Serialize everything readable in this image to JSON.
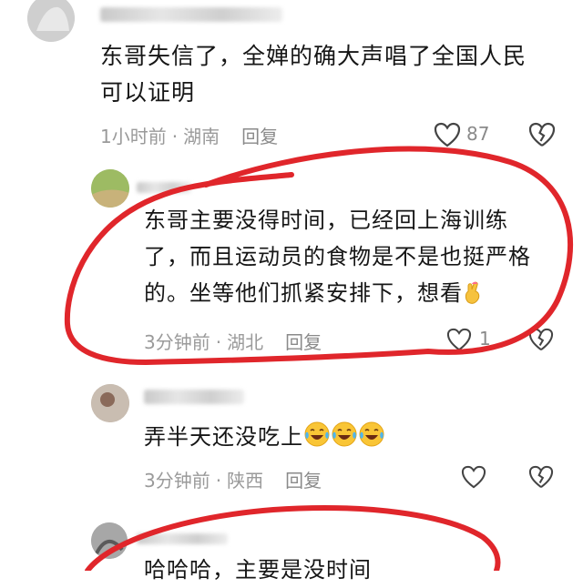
{
  "comments": [
    {
      "text": "东哥失信了，全婵的确大声唱了全国人民可以证明",
      "line1": "东哥失信了，全婵的确大声唱了全国人民",
      "line2": "可以证明",
      "time": "1小时前",
      "location": "湖南",
      "reply_label": "回复",
      "likes": "87"
    },
    {
      "line1": "东哥主要没得时间，已经回上海训练",
      "line2": "了，而且运动员的食物是不是也挺严格",
      "line3": "的。坐等他们抓紧安排下，想看",
      "time": "3分钟前",
      "location": "湖北",
      "reply_label": "回复",
      "likes": "1"
    },
    {
      "line1": "弄半天还没吃上",
      "time": "3分钟前",
      "location": "陕西",
      "reply_label": "回复"
    },
    {
      "line1": "哈哈哈，主要是没时间"
    }
  ],
  "colors": {
    "circle": "#e0262b",
    "meta": "#9a9a9a"
  },
  "icons": [
    "heart-icon",
    "broken-heart-icon",
    "crossed-fingers-emoji",
    "laughing-tears-emoji"
  ]
}
